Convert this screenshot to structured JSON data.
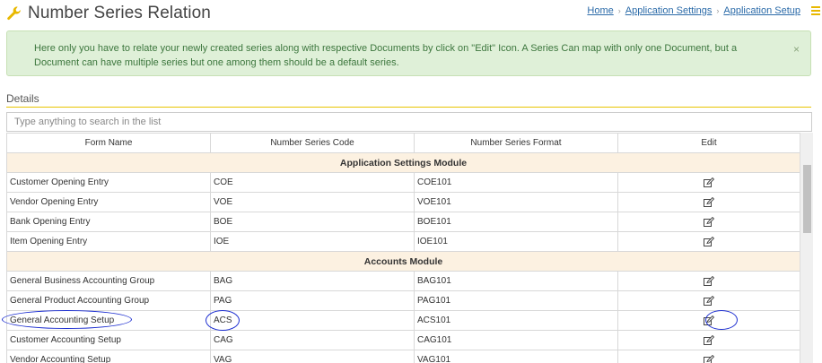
{
  "header": {
    "title": "Number Series Relation",
    "icon": "wrench-icon",
    "breadcrumb": [
      "Home",
      "Application Settings",
      "Application Setup"
    ],
    "separator": "›",
    "accent_color": "#e8b800"
  },
  "alert": {
    "text": "Here only you have to relate your newly created series along with respective Documents by click on \"Edit\" Icon. A Series Can map with only one Document, but a Document can have multiple series but one among them should be a default series.",
    "close": "×",
    "background": "#dff0d8"
  },
  "details": {
    "label": "Details",
    "search_placeholder": "Type anything to search in the list"
  },
  "table": {
    "columns": [
      "Form Name",
      "Number Series Code",
      "Number Series Format",
      "Edit"
    ],
    "module_1": "Application Settings Module",
    "module_2": "Accounts Module",
    "rows_1": [
      {
        "form": "Customer Opening Entry",
        "code": "COE",
        "format": "COE101"
      },
      {
        "form": "Vendor Opening Entry",
        "code": "VOE",
        "format": "VOE101"
      },
      {
        "form": "Bank Opening Entry",
        "code": "BOE",
        "format": "BOE101"
      },
      {
        "form": "Item Opening Entry",
        "code": "IOE",
        "format": "IOE101"
      }
    ],
    "rows_2": [
      {
        "form": "General Business Accounting Group",
        "code": "BAG",
        "format": "BAG101"
      },
      {
        "form": "General Product Accounting Group",
        "code": "PAG",
        "format": "PAG101"
      },
      {
        "form": "General Accounting Setup",
        "code": "ACS",
        "format": "ACS101"
      },
      {
        "form": "Customer Accounting Setup",
        "code": "CAG",
        "format": "CAG101"
      },
      {
        "form": "Vendor Accounting Setup",
        "code": "VAG",
        "format": "VAG101"
      }
    ]
  }
}
